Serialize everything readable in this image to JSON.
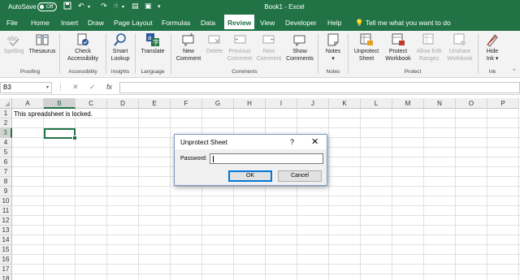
{
  "app": {
    "title": "Book1 - Excel",
    "autosave_label": "AutoSave",
    "autosave_state": "Off"
  },
  "tabs": [
    {
      "label": "File"
    },
    {
      "label": "Home"
    },
    {
      "label": "Insert"
    },
    {
      "label": "Draw"
    },
    {
      "label": "Page Layout"
    },
    {
      "label": "Formulas"
    },
    {
      "label": "Data"
    },
    {
      "label": "Review"
    },
    {
      "label": "View"
    },
    {
      "label": "Developer"
    },
    {
      "label": "Help"
    }
  ],
  "active_tab": "Review",
  "tell_me": "Tell me what you want to do",
  "ribbon": {
    "buttons": {
      "spelling": "Spelling",
      "thesaurus": "Thesaurus",
      "check_accessibility_1": "Check",
      "check_accessibility_2": "Accessibility",
      "smart_lookup_1": "Smart",
      "smart_lookup_2": "Lookup",
      "translate": "Translate",
      "new_comment_1": "New",
      "new_comment_2": "Comment",
      "delete": "Delete",
      "previous_comment_1": "Previous",
      "previous_comment_2": "Comment",
      "next_comment_1": "Next",
      "next_comment_2": "Comment",
      "show_comments_1": "Show",
      "show_comments_2": "Comments",
      "notes": "Notes",
      "unprotect_sheet_1": "Unprotect",
      "unprotect_sheet_2": "Sheet",
      "protect_workbook_1": "Protect",
      "protect_workbook_2": "Workbook",
      "allow_edit_ranges_1": "Allow Edit",
      "allow_edit_ranges_2": "Ranges",
      "unshare_workbook_1": "Unshare",
      "unshare_workbook_2": "Workbook",
      "hide_ink_1": "Hide",
      "hide_ink_2": "Ink"
    },
    "groups": {
      "proofing": "Proofing",
      "accessibility": "Accessibility",
      "insights": "Insights",
      "language": "Language",
      "comments": "Comments",
      "notes": "Notes",
      "protect": "Protect",
      "ink": "Ink"
    }
  },
  "formula_bar": {
    "name_box": "B3",
    "cancel": "✕",
    "enter": "✓",
    "fx": "fx",
    "value": ""
  },
  "grid": {
    "columns": [
      "A",
      "B",
      "C",
      "D",
      "E",
      "F",
      "G",
      "H",
      "I",
      "J",
      "K",
      "L",
      "M",
      "N",
      "O",
      "P"
    ],
    "rows": [
      "1",
      "2",
      "3",
      "4",
      "5",
      "6",
      "7",
      "8",
      "9",
      "10",
      "11",
      "12",
      "13",
      "14",
      "15",
      "16",
      "17",
      "18"
    ],
    "selected_cell": "B3",
    "cell_a1": "This spreadsheet is locked."
  },
  "dialog": {
    "title": "Unprotect Sheet",
    "help": "?",
    "close": "✕",
    "password_label": "Password:",
    "password_value": "",
    "ok": "OK",
    "cancel": "Cancel"
  }
}
